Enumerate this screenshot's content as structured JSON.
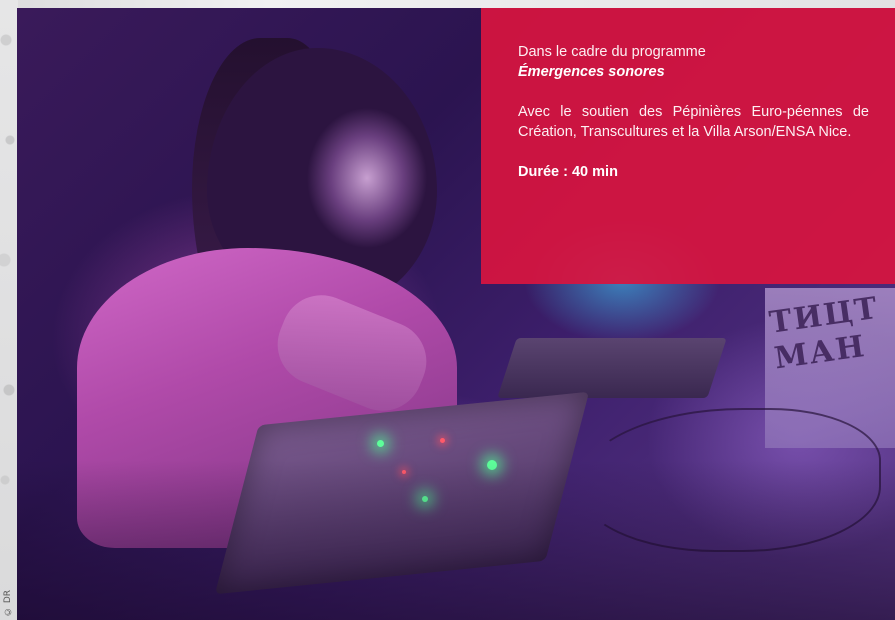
{
  "photo_credit": "© DR",
  "graffiti_text": "ТИЦТ\nМАН",
  "info": {
    "program_intro": "Dans le cadre du programme",
    "program_name": "Émergences sonores",
    "support": "Avec le soutien des Pépinières Euro-péennes de Création, Transcultures et la Villa Arson/ENSA Nice.",
    "duration": "Durée : 40 min"
  },
  "colors": {
    "panel": "#d71440",
    "page_background": "#e9e9ea"
  }
}
